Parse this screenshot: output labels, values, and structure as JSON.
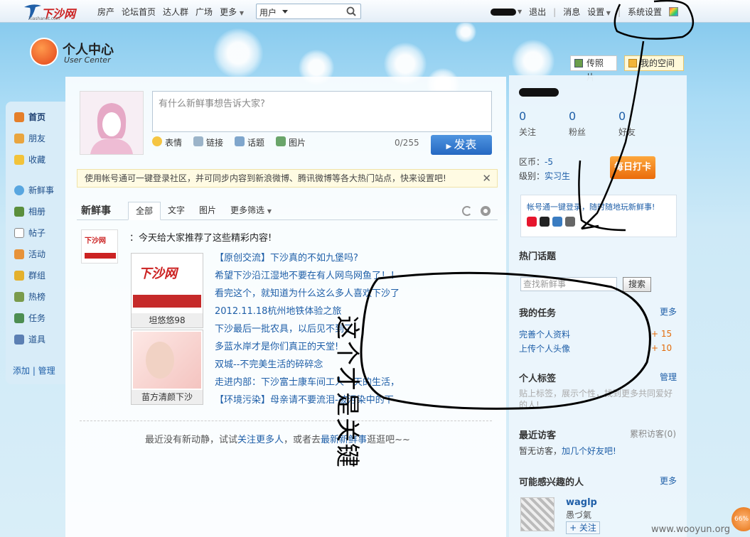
{
  "topbar": {
    "logo_text": "下沙网",
    "logo_sub": "Xiashanet.com",
    "nav": [
      "房产",
      "论坛首页",
      "达人群",
      "广场",
      "更多"
    ],
    "search_select": "用户",
    "search_placeholder": "",
    "user_links": [
      "退出",
      "消息",
      "设置",
      "系统设置"
    ]
  },
  "header": {
    "title": "个人中心",
    "subtitle": "User Center",
    "photo_button": "传照片",
    "space_button": "我的空间"
  },
  "leftnav": {
    "items": [
      {
        "label": "首页",
        "icon": "home-icon",
        "active": true
      },
      {
        "label": "朋友",
        "icon": "friends-icon"
      },
      {
        "label": "收藏",
        "icon": "star-icon"
      },
      {
        "label": "新鲜事",
        "icon": "bubble-icon"
      },
      {
        "label": "相册",
        "icon": "album-icon"
      },
      {
        "label": "帖子",
        "icon": "post-icon"
      },
      {
        "label": "活动",
        "icon": "activity-icon"
      },
      {
        "label": "群组",
        "icon": "group-icon"
      },
      {
        "label": "热榜",
        "icon": "chart-icon"
      },
      {
        "label": "任务",
        "icon": "task-icon"
      },
      {
        "label": "道具",
        "icon": "tool-icon"
      }
    ],
    "footer": "添加 | 管理"
  },
  "composer": {
    "placeholder": "有什么新鲜事想告诉大家?",
    "tools": [
      "表情",
      "链接",
      "话题",
      "图片"
    ],
    "counter": "0/255",
    "publish": "发表"
  },
  "notice": {
    "text": "使用帐号通可一键登录社区，并可同步内容到新浪微博、腾讯微博等各大热门站点，快来设置吧!",
    "close": "✕"
  },
  "feed": {
    "title": "新鲜事",
    "tabs": [
      "全部",
      "文字",
      "图片",
      "更多筛选"
    ],
    "intro": "：今天给大家推荐了这些精彩内容!",
    "thumbs": [
      {
        "caption": "坦悠悠98",
        "logo": "下沙网"
      },
      {
        "caption": "苗方清颜下沙"
      }
    ],
    "links": [
      "【原创交流】下沙真的不如九堡吗?",
      "希望下沙沿江湿地不要在有人网鸟网鱼了！！",
      "看完这个，就知道为什么这么多人喜欢下沙了",
      "2012.11.18杭州地铁体验之旅",
      "下沙最后一批农具，以后见不到了",
      "多蓝水岸才是你们真正的天堂!",
      "双城--不完美生活的碎碎念",
      "走进内部：下沙富士康车间工人一天的生活，",
      "【环境污染】母亲请不要流泪-被污染中的下"
    ],
    "empty_prefix": "最近没有新动静，试试",
    "empty_link1": "关注更多人",
    "empty_mid": "，或者去",
    "empty_link2": "最新新鲜事",
    "empty_suffix": "逛逛吧~~"
  },
  "sidebar": {
    "stats": [
      {
        "value": "0",
        "label": "关注"
      },
      {
        "value": "0",
        "label": "粉丝"
      },
      {
        "value": "0",
        "label": "好友"
      }
    ],
    "credit_label": "区币：",
    "credit_value": "-5",
    "level_label": "级别：",
    "level_value": "实习生",
    "checkin": "每日打卡",
    "login_text": "帐号通一键登录，随时随地玩新鲜事!",
    "hot_topics": "热门话题",
    "search_placeholder": "查找新鲜事",
    "search_button": "搜索",
    "my_tasks": "我的任务",
    "more": "更多",
    "tasks": [
      {
        "label": "完善个人资料",
        "points": "+ 15"
      },
      {
        "label": "上传个人头像",
        "points": "+ 10"
      }
    ],
    "tags_title": "个人标签",
    "tags_manage": "管理",
    "tags_hint": "贴上标签，展示个性，找到更多共同爱好的人!",
    "visitors_title": "最近访客",
    "visitors_count": "累积访客(0)",
    "visitors_empty": "暂无访客，",
    "visitors_link": "加几个好友吧!",
    "interest_title": "可能感兴趣的人",
    "friend_name": "waglp",
    "friend_sub": "愚づ氣",
    "follow": "+ 关注"
  },
  "annotation": {
    "handwriting": "这个才是关键"
  },
  "footer": {
    "watermark": "www.wooyun.org",
    "badge": "66%"
  }
}
